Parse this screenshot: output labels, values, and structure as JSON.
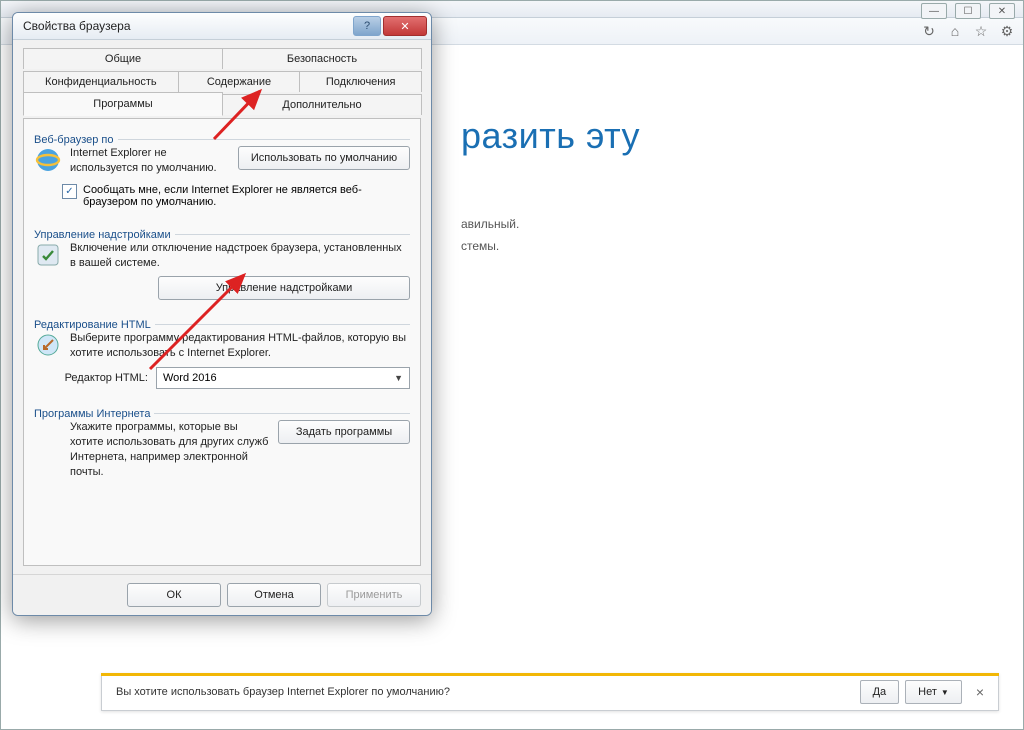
{
  "browser": {
    "page_heading_fragment": "разить эту",
    "bg_line1": "авильный.",
    "bg_line2": "стемы."
  },
  "notification": {
    "text": "Вы хотите использовать браузер Internet Explorer по умолчанию?",
    "yes": "Да",
    "no": "Нет"
  },
  "dialog": {
    "title": "Свойства браузера",
    "tabs_row1": [
      "Общие",
      "Безопасность",
      "Конфиденциальность"
    ],
    "tabs_row2": [
      "Содержание",
      "Подключения",
      "Программы",
      "Дополнительно"
    ],
    "active_tab": "Программы",
    "groups": {
      "default_browser": {
        "title": "Веб-браузер по",
        "desc": "Internet Explorer не используется по умолчанию.",
        "button": "Использовать по умолчанию",
        "checkbox_label": "Сообщать мне, если Internet Explorer не является веб-браузером по умолчанию.",
        "checkbox_checked": true
      },
      "addons": {
        "title": "Управление надстройками",
        "desc": "Включение или отключение надстроек браузера, установленных в вашей системе.",
        "button": "Управление надстройками"
      },
      "html_edit": {
        "title": "Редактирование HTML",
        "desc": "Выберите программу редактирования HTML-файлов, которую вы хотите использовать с Internet Explorer.",
        "label": "Редактор HTML:",
        "value": "Word 2016"
      },
      "internet_programs": {
        "title": "Программы Интернета",
        "desc": "Укажите программы, которые вы хотите использовать для других служб Интернета, например электронной почты.",
        "button": "Задать программы"
      }
    },
    "footer": {
      "ok": "ОК",
      "cancel": "Отмена",
      "apply": "Применить"
    }
  }
}
